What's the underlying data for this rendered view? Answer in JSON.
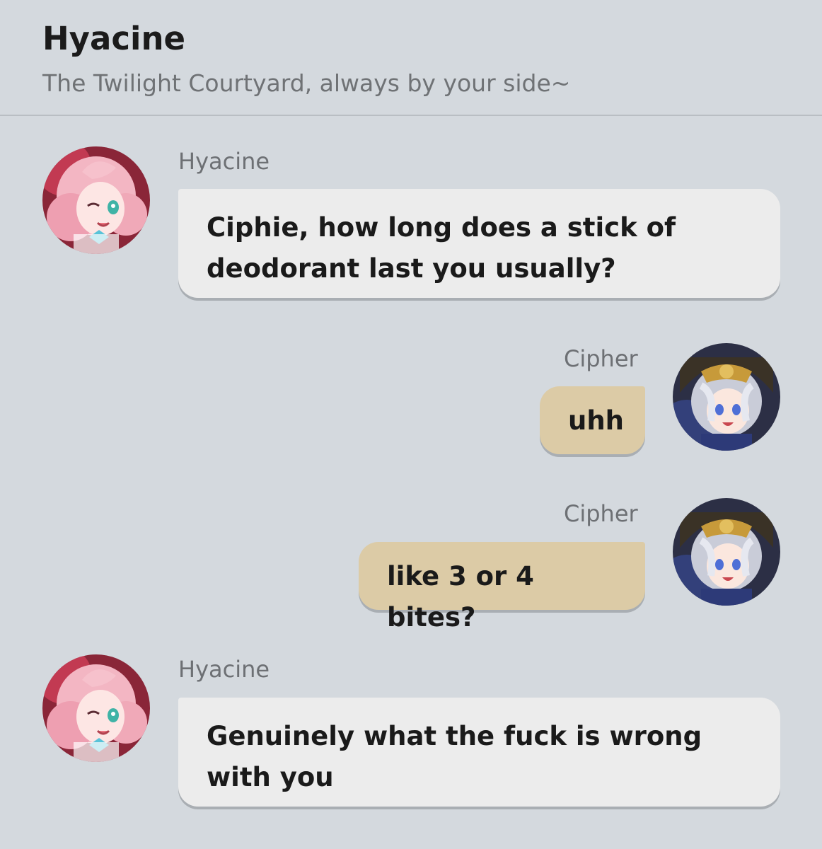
{
  "header": {
    "title": "Hyacine",
    "subtitle": "The Twilight Courtyard, always by your side~"
  },
  "messages": [
    {
      "sender": "Hyacine",
      "side": "incoming",
      "text": "Ciphie, how long does a stick of deodorant last you usually?"
    },
    {
      "sender": "Cipher",
      "side": "outgoing",
      "text": "uhh"
    },
    {
      "sender": "Cipher",
      "side": "outgoing",
      "text": "like 3 or 4 bites?"
    },
    {
      "sender": "Hyacine",
      "side": "incoming",
      "text": "Genuinely what the fuck is wrong with you"
    }
  ],
  "colors": {
    "background": "#d4d9de",
    "incoming_bubble": "#ececec",
    "outgoing_bubble": "#dccba6"
  }
}
